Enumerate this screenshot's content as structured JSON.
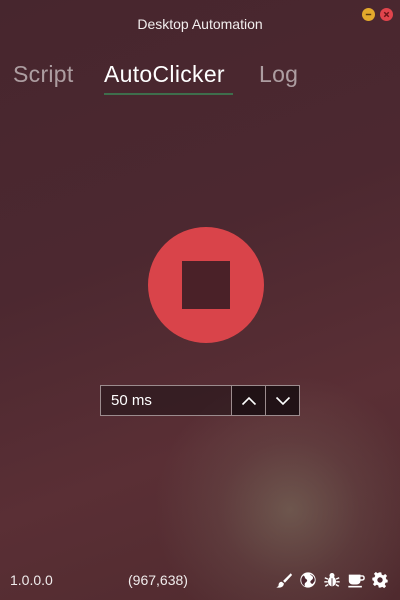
{
  "window": {
    "title": "Desktop Automation",
    "controls": {
      "minimize_icon": "minimize-icon",
      "close_icon": "close-icon"
    }
  },
  "tabs": [
    {
      "label": "Script",
      "active": false
    },
    {
      "label": "AutoClicker",
      "active": true
    },
    {
      "label": "Log",
      "active": false
    }
  ],
  "autoclicker": {
    "state": "running",
    "toggle_icon": "stop-icon",
    "interval": {
      "value": "50 ms"
    }
  },
  "footer": {
    "version": "1.0.0.0",
    "cursor_position": "(967,638)",
    "icons": [
      "brush-icon",
      "globe-icon",
      "bug-icon",
      "coffee-icon",
      "gear-icon"
    ]
  },
  "colors": {
    "accent": "#d9444a",
    "tab_underline": "#3e6e4c",
    "minimize": "#e3a92c",
    "close": "#e0444c"
  }
}
